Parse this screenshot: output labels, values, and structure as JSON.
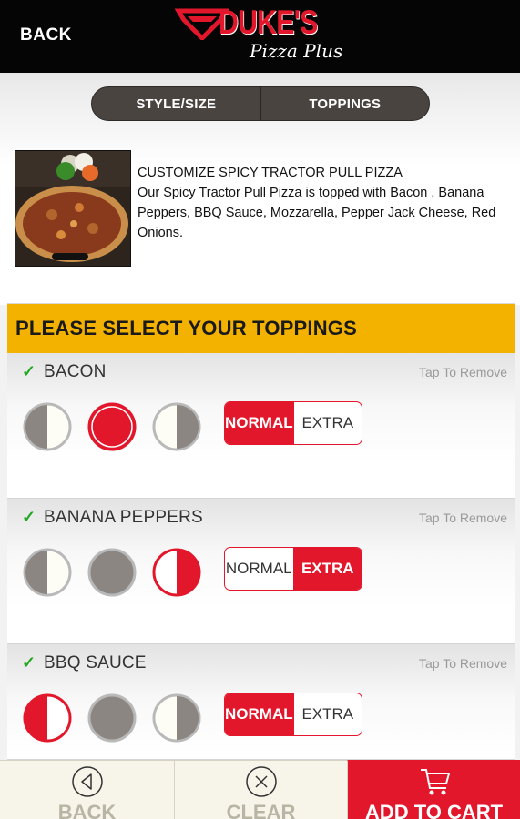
{
  "header": {
    "back_label": "BACK",
    "logo_brand": "DUKE'S",
    "logo_tagline": "Pizza Plus"
  },
  "tabs": [
    {
      "label": "STYLE/SIZE"
    },
    {
      "label": "TOPPINGS"
    }
  ],
  "product": {
    "image": "spicy-tractor-pull-pizza-photo",
    "title": "CUSTOMIZE SPICY TRACTOR PULL PIZZA",
    "description": "Our Spicy Tractor Pull Pizza is topped with Bacon , Banana Peppers, BBQ Sauce, Mozzarella, Pepper Jack Cheese, Red Onions."
  },
  "toppings_section": {
    "title": "PLEASE SELECT YOUR TOPPINGS",
    "remove_label": "Tap To Remove",
    "normal_label": "NORMAL",
    "extra_label": "EXTRA",
    "items": [
      {
        "name": "BACON",
        "checked": true,
        "placement": "whole",
        "amount": "normal"
      },
      {
        "name": "BANANA PEPPERS",
        "checked": true,
        "placement": "right-half",
        "amount": "extra"
      },
      {
        "name": "BBQ SAUCE",
        "checked": true,
        "placement": "left-half",
        "amount": "normal"
      }
    ]
  },
  "bottom_bar": {
    "back_label": "BACK",
    "clear_label": "CLEAR",
    "cart_label": "ADD TO CART"
  },
  "colors": {
    "accent_red": "#e3172b",
    "section_yellow": "#f3b200",
    "header_black": "#050505",
    "check_green": "#22a822"
  }
}
